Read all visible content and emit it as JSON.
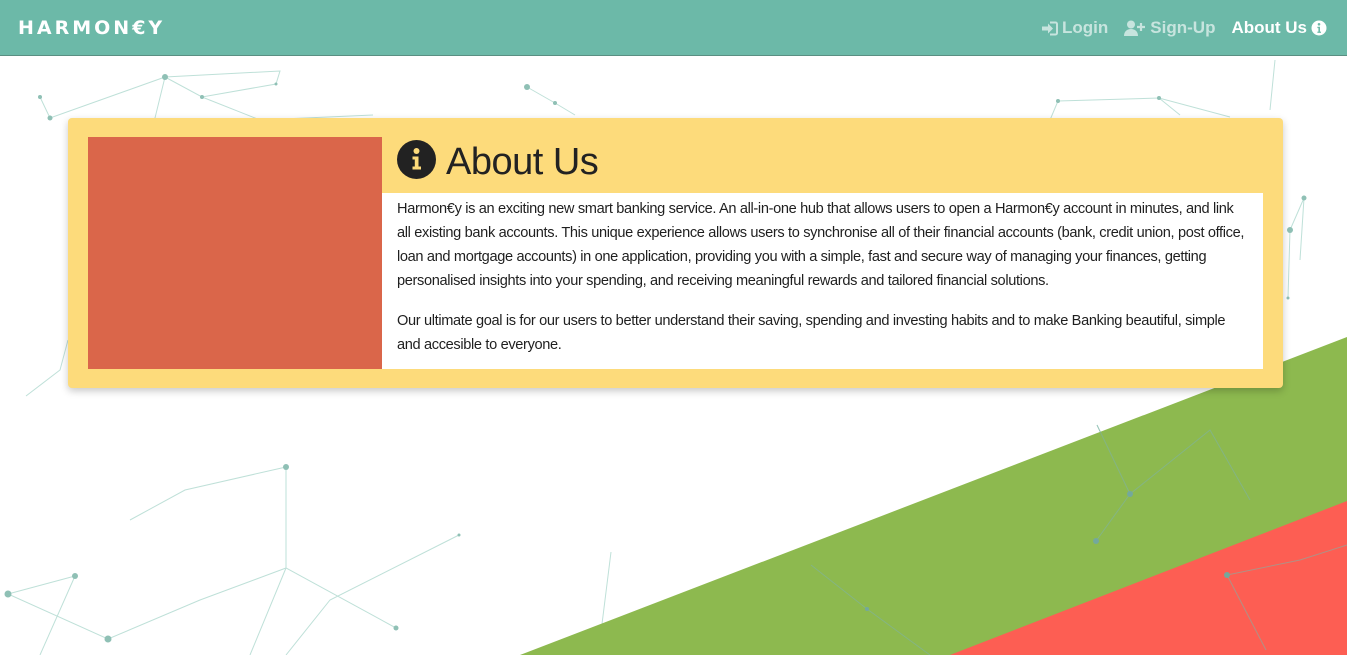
{
  "navbar": {
    "brand": "HARMON€Y",
    "links": [
      {
        "label": "Login",
        "icon": "sign-in-icon"
      },
      {
        "label": "Sign-Up",
        "icon": "user-plus-icon"
      },
      {
        "label": "About Us",
        "icon": "info-circle-icon"
      }
    ]
  },
  "about": {
    "title": "About Us",
    "icon": "info-circle-icon",
    "paragraphs": [
      "Harmon€y is an exciting new smart banking service. An all-in-one hub that allows users to open a Harmon€y account in minutes, and link all existing bank accounts. This unique experience allows users to synchronise all of their financial accounts (bank, credit union, post office, loan and mortgage accounts) in one application, providing you with a simple, fast and secure way of managing your finances, getting personalised insights into your spending, and receiving meaningful rewards and tailored financial solutions.",
      "Our ultimate goal is for our users to better understand their saving, spending and investing habits and to make Banking beautiful, simple and accesible to everyone."
    ]
  },
  "colors": {
    "navbar": "#6cb9a8",
    "card": "#fddb7b",
    "image_placeholder": "#da664a",
    "green_band": "#8db94f",
    "red_band": "#fd5e53",
    "network_lines": "#9ccfc3"
  }
}
